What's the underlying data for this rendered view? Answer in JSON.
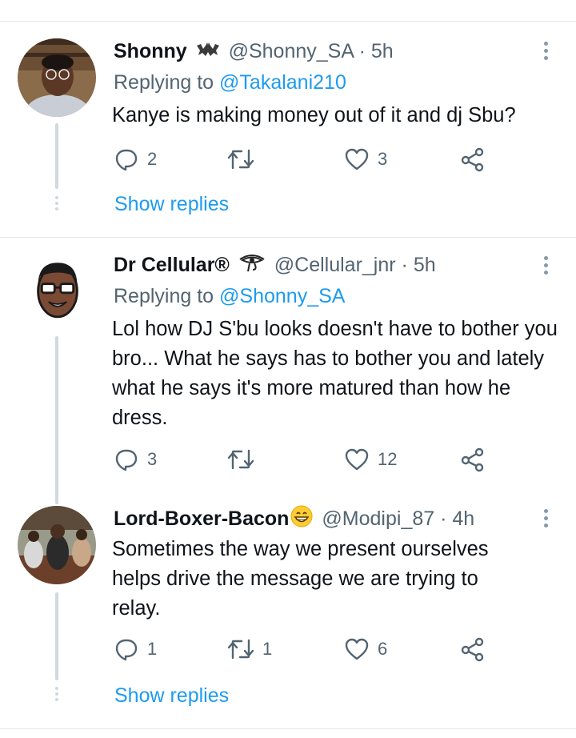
{
  "tweets": [
    {
      "name": "Shonny",
      "handle": "@Shonny_SA",
      "separator": "·",
      "time": "5h",
      "replying_prefix": "Replying to",
      "replying_to": "@Takalani210",
      "text": "Kanye is making money out of it and dj Sbu?",
      "replies": "2",
      "retweets": "",
      "likes": "3",
      "show_replies": "Show replies"
    },
    {
      "name": "Dr Cellular®",
      "handle": "@Cellular_jnr",
      "separator": "·",
      "time": "5h",
      "replying_prefix": "Replying to",
      "replying_to": "@Shonny_SA",
      "text": "Lol how DJ S'bu looks doesn't have to bother you bro... What he says has to bother you and lately what he says it's more matured than how he dress.",
      "replies": "3",
      "retweets": "",
      "likes": "12"
    },
    {
      "name": "Lord-Boxer-Bacon",
      "handle": "@Modipi_87",
      "separator": "·",
      "time": "4h",
      "text": "Sometimes the way we present ourselves helps drive the message we are trying to relay.",
      "replies": "1",
      "retweets": "1",
      "likes": "6",
      "show_replies": "Show replies"
    }
  ],
  "colors": {
    "link": "#1d9bf0",
    "secondary_text": "#536471",
    "primary_text": "#0f1419",
    "divider": "#e1e8ed"
  },
  "icons": [
    "reply-icon",
    "retweet-icon",
    "like-icon",
    "share-icon",
    "more-icon"
  ]
}
